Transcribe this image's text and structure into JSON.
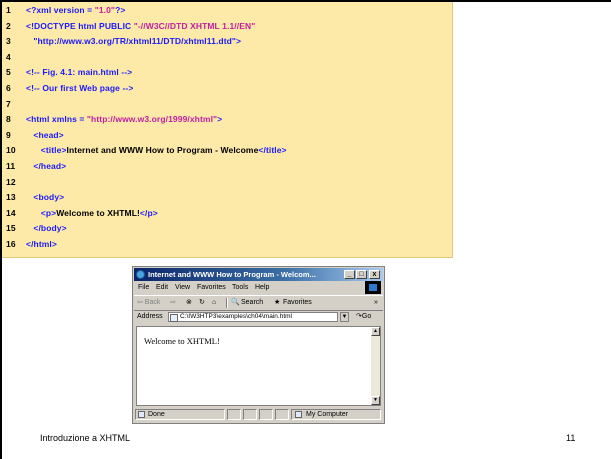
{
  "code_listing": {
    "lines": [
      {
        "num": "1",
        "parts": [
          {
            "t": "<?xml version = ",
            "c": "blue"
          },
          {
            "t": "\"1.0\"",
            "c": "mag"
          },
          {
            "t": "?>",
            "c": "blue"
          }
        ]
      },
      {
        "num": "2",
        "parts": [
          {
            "t": "<!DOCTYPE html PUBLIC ",
            "c": "blue"
          },
          {
            "t": "\"-//W3C//DTD XHTML 1.1//EN\"",
            "c": "mag"
          }
        ]
      },
      {
        "num": "3",
        "parts": [
          {
            "t": "   \"http://www.w3.org/TR/xhtml11/DTD/xhtml11.dtd\">",
            "c": "blue"
          }
        ]
      },
      {
        "num": "4",
        "parts": []
      },
      {
        "num": "5",
        "parts": [
          {
            "t": "<!-- Fig. 4.1: main.html -->",
            "c": "blue"
          }
        ]
      },
      {
        "num": "6",
        "parts": [
          {
            "t": "<!-- Our first Web page -->",
            "c": "blue"
          }
        ]
      },
      {
        "num": "7",
        "parts": []
      },
      {
        "num": "8",
        "parts": [
          {
            "t": "<html xmlns = ",
            "c": "blue"
          },
          {
            "t": "\"http://www.w3.org/1999/xhtml\"",
            "c": "mag"
          },
          {
            "t": ">",
            "c": "blue"
          }
        ]
      },
      {
        "num": "9",
        "parts": [
          {
            "t": "   <head>",
            "c": "blue"
          }
        ]
      },
      {
        "num": "10",
        "parts": [
          {
            "t": "      <title>",
            "c": "blue"
          },
          {
            "t": "Internet and WWW How to Program - Welcome",
            "c": "blk"
          },
          {
            "t": "</title>",
            "c": "blue"
          }
        ]
      },
      {
        "num": "11",
        "parts": [
          {
            "t": "   </head>",
            "c": "blue"
          }
        ]
      },
      {
        "num": "12",
        "parts": []
      },
      {
        "num": "13",
        "parts": [
          {
            "t": "   <body>",
            "c": "blue"
          }
        ]
      },
      {
        "num": "14",
        "parts": [
          {
            "t": "      <p>",
            "c": "blue"
          },
          {
            "t": "Welcome to XHTML!",
            "c": "blk"
          },
          {
            "t": "</p>",
            "c": "blue"
          }
        ]
      },
      {
        "num": "15",
        "parts": [
          {
            "t": "   </body>",
            "c": "blue"
          }
        ]
      },
      {
        "num": "16",
        "parts": [
          {
            "t": "</html>",
            "c": "blue"
          }
        ]
      }
    ]
  },
  "browser": {
    "title": "Internet and WWW How to Program - Welcom...",
    "window_buttons": {
      "minimize": "_",
      "maximize": "□",
      "close": "x"
    },
    "menu": [
      "File",
      "Edit",
      "View",
      "Favorites",
      "Tools",
      "Help"
    ],
    "toolbar": {
      "back": "⇦ Back",
      "forward": "⇨",
      "stop": "⊗",
      "refresh": "↻",
      "home": "⌂",
      "search": "Search",
      "favorites": "Favorites",
      "more": "»"
    },
    "address_label": "Address",
    "address_value": "C:\\IW3HTP3\\examples\\ch04\\main.html",
    "go_label": "Go",
    "page_text": "Welcome to XHTML!",
    "status_done": "Done",
    "status_zone": "My Computer"
  },
  "footer": {
    "title": "Introduzione a XHTML",
    "page_number": "11"
  },
  "colors": {
    "code_background": "#fde9a8",
    "tag_blue": "#1a1aff",
    "string_magenta": "#c21ea1",
    "title_bar": "#0a246a"
  }
}
